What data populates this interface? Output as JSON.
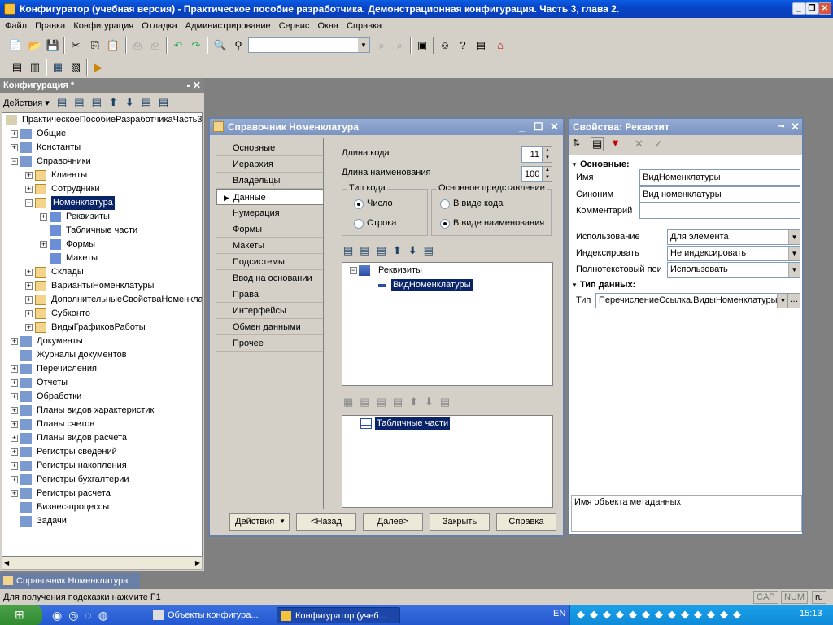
{
  "app": {
    "title": "Конфигуратор (учебная версия) - Практическое пособие разработчика. Демонстрационная конфигурация. Часть 3, глава 2.",
    "controls": [
      "_",
      "❐",
      "✕"
    ]
  },
  "menu": [
    "Файл",
    "Правка",
    "Конфигурация",
    "Отладка",
    "Администрирование",
    "Сервис",
    "Окна",
    "Справка"
  ],
  "config_panel": {
    "title": "Конфигурация *",
    "pin": "▪ ✕",
    "actions_label": "Действия ▾",
    "tree": [
      {
        "label": "ПрактическоеПособиеРазработчикаЧасть3",
        "level": 0,
        "pm": ""
      },
      {
        "label": "Общие",
        "level": 1,
        "pm": "+"
      },
      {
        "label": "Константы",
        "level": 1,
        "pm": "+"
      },
      {
        "label": "Справочники",
        "level": 1,
        "pm": "−"
      },
      {
        "label": "Клиенты",
        "level": 2,
        "pm": "+"
      },
      {
        "label": "Сотрудники",
        "level": 2,
        "pm": "+"
      },
      {
        "label": "Номенклатура",
        "level": 2,
        "pm": "−",
        "selected": true
      },
      {
        "label": "Реквизиты",
        "level": 3,
        "pm": "+"
      },
      {
        "label": "Табличные части",
        "level": 3,
        "pm": ""
      },
      {
        "label": "Формы",
        "level": 3,
        "pm": "+"
      },
      {
        "label": "Макеты",
        "level": 3,
        "pm": ""
      },
      {
        "label": "Склады",
        "level": 2,
        "pm": "+"
      },
      {
        "label": "ВариантыНоменклатуры",
        "level": 2,
        "pm": "+"
      },
      {
        "label": "ДополнительныеСвойстваНоменклатуры",
        "level": 2,
        "pm": "+"
      },
      {
        "label": "Субконто",
        "level": 2,
        "pm": "+"
      },
      {
        "label": "ВидыГрафиковРаботы",
        "level": 2,
        "pm": "+"
      },
      {
        "label": "Документы",
        "level": 1,
        "pm": "+"
      },
      {
        "label": "Журналы документов",
        "level": 1,
        "pm": ""
      },
      {
        "label": "Перечисления",
        "level": 1,
        "pm": "+"
      },
      {
        "label": "Отчеты",
        "level": 1,
        "pm": "+"
      },
      {
        "label": "Обработки",
        "level": 1,
        "pm": "+"
      },
      {
        "label": "Планы видов характеристик",
        "level": 1,
        "pm": "+"
      },
      {
        "label": "Планы счетов",
        "level": 1,
        "pm": "+"
      },
      {
        "label": "Планы видов расчета",
        "level": 1,
        "pm": "+"
      },
      {
        "label": "Регистры сведений",
        "level": 1,
        "pm": "+"
      },
      {
        "label": "Регистры накопления",
        "level": 1,
        "pm": "+"
      },
      {
        "label": "Регистры бухгалтерии",
        "level": 1,
        "pm": "+"
      },
      {
        "label": "Регистры расчета",
        "level": 1,
        "pm": "+"
      },
      {
        "label": "Бизнес-процессы",
        "level": 1,
        "pm": ""
      },
      {
        "label": "Задачи",
        "level": 1,
        "pm": ""
      }
    ]
  },
  "dialog": {
    "title": "Справочник Номенклатура",
    "tabs": [
      "Основные",
      "Иерархия",
      "Владельцы",
      "Данные",
      "Нумерация",
      "Формы",
      "Макеты",
      "Подсистемы",
      "Ввод на основании",
      "Права",
      "Интерфейсы",
      "Обмен данными",
      "Прочее"
    ],
    "active_tab": "Данные",
    "code_length_label": "Длина кода",
    "code_length": "11",
    "name_length_label": "Длина наименования",
    "name_length": "100",
    "code_type_label": "Тип кода",
    "code_type_number": "Число",
    "code_type_string": "Строка",
    "main_repr_label": "Основное представление",
    "repr_code": "В виде кода",
    "repr_name": "В виде наименования",
    "attributes_root": "Реквизиты",
    "attribute_selected": "ВидНоменклатуры",
    "tabular_root": "Табличные части",
    "buttons": {
      "actions": "Действия",
      "back": "<Назад",
      "next": "Далее>",
      "close": "Закрыть",
      "help": "Справка"
    }
  },
  "properties": {
    "title": "Свойства: Реквизит",
    "section_main": "Основные:",
    "name_label": "Имя",
    "name_value": "ВидНоменклатуры",
    "synonym_label": "Синоним",
    "synonym_value": "Вид номенклатуры",
    "comment_label": "Комментарий",
    "comment_value": "",
    "usage_label": "Использование",
    "usage_value": "Для элемента",
    "index_label": "Индексировать",
    "index_value": "Не индексировать",
    "fulltext_label": "Полнотекстовый пои",
    "fulltext_value": "Использовать",
    "section_type": "Тип данных:",
    "type_label": "Тип",
    "type_value": "ПеречислениеСсылка.ВидыНоменклатуры",
    "description": "Имя объекта метаданных"
  },
  "window_tab": "Справочник Номенклатура",
  "statusbar": {
    "hint": "Для получения подсказки нажмите F1",
    "cap": "CAP",
    "num": "NUM",
    "lang": "ru"
  },
  "taskbar": {
    "tasks": [
      "Объекты конфигура...",
      "Конфигуратор (учеб..."
    ],
    "lang": "EN",
    "clock": "15:13"
  }
}
